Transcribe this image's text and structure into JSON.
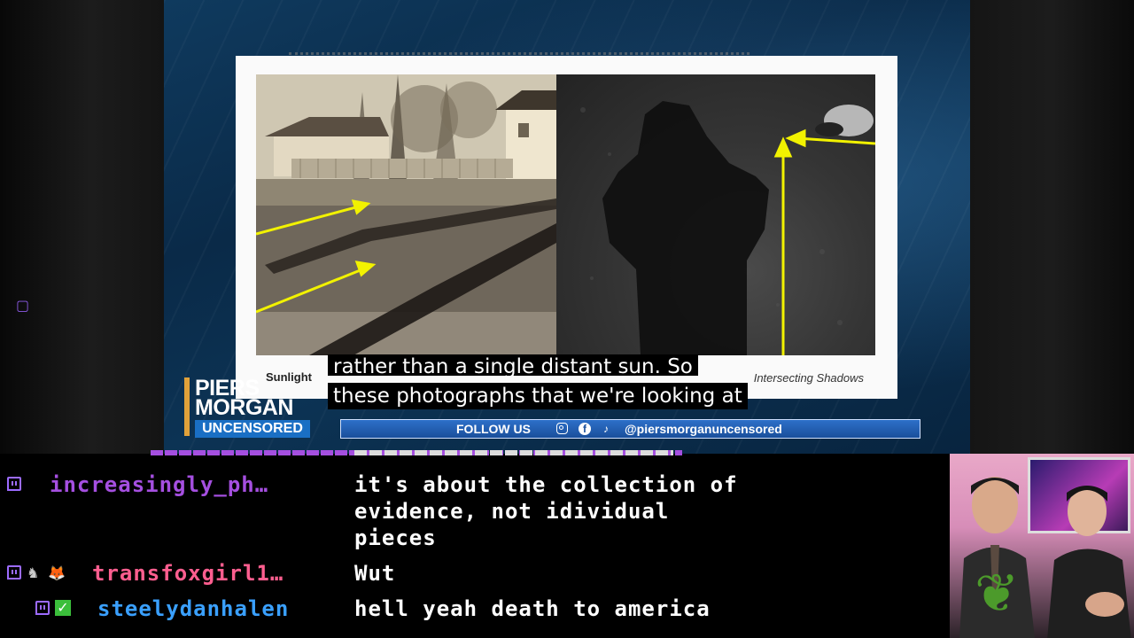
{
  "video": {
    "slide": {
      "caption_left": "Sunlight",
      "caption_right": "Intersecting Shadows"
    },
    "logo": {
      "line1": "PIERS",
      "line2": "MORGAN",
      "badge": "UNCENSORED"
    },
    "follow_bar": {
      "label": "FOLLOW US",
      "icons": [
        "instagram-icon",
        "facebook-icon",
        "tiktok-icon"
      ],
      "handle": "@piersmorganuncensored"
    },
    "subtitles": {
      "line1": "rather than a single distant sun. So",
      "line2": "these photographs that we're looking at"
    }
  },
  "chat": {
    "messages": [
      {
        "user": "increasingly_ph…",
        "text_lines": [
          "it's about the collection of",
          "evidence, not idividual",
          "pieces"
        ],
        "color": "#a54fe0",
        "badges": [
          "twitch-badge"
        ]
      },
      {
        "user": "transfoxgirl1…",
        "text_lines": [
          "Wut"
        ],
        "color": "#ff5e8f",
        "badges": [
          "twitch-badge",
          "chess-badge",
          "fox-badge"
        ]
      },
      {
        "user": "steelydanhalen",
        "text_lines": [
          "hell yeah death to america"
        ],
        "color": "#3aa0ff",
        "badges": [
          "twitch-badge",
          "check-badge"
        ]
      }
    ]
  },
  "colors": {
    "chat_bg": "#000000",
    "follow_bar": "#1a4f9b",
    "logo_accent": "#e0a13a",
    "badge_blue": "#1a6fc4"
  }
}
